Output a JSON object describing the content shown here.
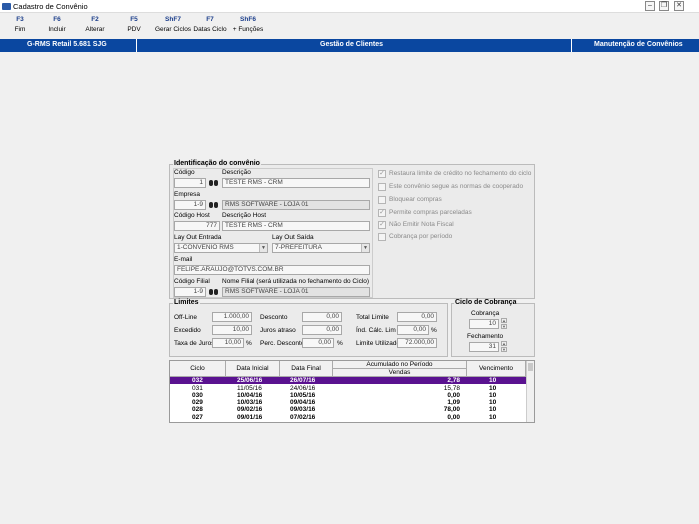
{
  "window": {
    "title": "Cadastro de Convênio"
  },
  "toolbar": [
    {
      "key": "F3",
      "label": "Fim"
    },
    {
      "key": "F6",
      "label": "Incluir"
    },
    {
      "key": "F2",
      "label": "Alterar"
    },
    {
      "key": "F5",
      "label": "PDV"
    },
    {
      "key": "ShF7",
      "label": "Gerar Ciclos"
    },
    {
      "key": "F7",
      "label": "Datas Ciclo"
    },
    {
      "key": "ShF6",
      "label": "+ Funções"
    }
  ],
  "header": {
    "left": "G-RMS Retail 5.681 SJG",
    "center": "Gestão de Clientes",
    "right": "Manutenção de Convênios"
  },
  "identificacao": {
    "group_title": "Identificação do convênio",
    "codigo_label": "Código",
    "codigo": "1",
    "descricao_label": "Descrição",
    "descricao": "TESTE RMS - CRM",
    "empresa_label": "Empresa",
    "empresa_code": "1-9",
    "empresa_name": "RMS SOFTWARE - LOJA 01",
    "codigo_host_label": "Código Host",
    "codigo_host": "777",
    "descricao_host_label": "Descrição Host",
    "descricao_host": "TESTE RMS - CRM",
    "layout_entrada_label": "Lay Out Entrada",
    "layout_entrada": "1-CONVENIO RMS",
    "layout_saida_label": "Lay Out Saída",
    "layout_saida": "7-PREFEITURA",
    "email_label": "E-mail",
    "email": "FELIPE.ARAUJO@TOTVS.COM.BR",
    "codigo_filial_label": "Código Filial",
    "codigo_filial": "1-9",
    "nome_filial_label": "Nome Filial (será utilizada no fechamento do Ciclo)",
    "nome_filial": "RMS SOFTWARE - LOJA 01"
  },
  "options": [
    {
      "label": "Restaura limite de crédito no fechamento do ciclo",
      "checked": true
    },
    {
      "label": "Este convênio segue as normas de cooperado",
      "checked": false
    },
    {
      "label": "Bloquear compras",
      "checked": false
    },
    {
      "label": "Permite compras parceladas",
      "checked": true
    },
    {
      "label": "Não Emitir Nota Fiscal",
      "checked": true
    },
    {
      "label": "Cobrança por período",
      "checked": false
    }
  ],
  "limites": {
    "group_title": "Limites",
    "offline_label": "Off-Line",
    "offline": "1.000,00",
    "excedido_label": "Excedido",
    "excedido": "10,00",
    "taxa_juros_label": "Taxa de Juros",
    "taxa_juros": "10,00",
    "taxa_juros_unit": "%",
    "desconto_label": "Desconto",
    "desconto": "0,00",
    "juros_atraso_label": "Juros atraso",
    "juros_atraso": "0,00",
    "perc_desconto_label": "Perc. Desconto",
    "perc_desconto": "0,00",
    "perc_desconto_unit": "%",
    "total_limite_label": "Total Limite",
    "total_limite": "0,00",
    "ind_calc_lim_label": "Índ. Cálc. Lim",
    "ind_calc_lim": "0,00",
    "ind_calc_lim_unit": "%",
    "limite_utilizado_label": "Limite Utilizado",
    "limite_utilizado": "72.000,00"
  },
  "ciclo_cobranca": {
    "group_title": "Ciclo de Cobrança",
    "cobranca_label": "Cobrança",
    "cobranca": "10",
    "fechamento_label": "Fechamento",
    "fechamento": "31"
  },
  "grid": {
    "headers": {
      "ciclo": "Ciclo",
      "data_inicial": "Data Inicial",
      "data_final": "Data Final",
      "acumulado": "Acumulado no Período",
      "vendas": "Vendas",
      "vencimento": "Vencimento"
    },
    "rows": [
      {
        "ciclo": "032",
        "data_inicial": "25/06/16",
        "data_final": "26/07/16",
        "vendas": "2,78",
        "vencimento": "10"
      },
      {
        "ciclo": "031",
        "data_inicial": "11/05/16",
        "data_final": "24/06/16",
        "vendas": "15,78",
        "vencimento": "10"
      },
      {
        "ciclo": "030",
        "data_inicial": "10/04/16",
        "data_final": "10/05/16",
        "vendas": "0,00",
        "vencimento": "10"
      },
      {
        "ciclo": "029",
        "data_inicial": "10/03/16",
        "data_final": "09/04/16",
        "vendas": "1,09",
        "vencimento": "10"
      },
      {
        "ciclo": "028",
        "data_inicial": "09/02/16",
        "data_final": "09/03/16",
        "vendas": "78,00",
        "vencimento": "10"
      },
      {
        "ciclo": "027",
        "data_inicial": "09/01/16",
        "data_final": "07/02/16",
        "vendas": "0,00",
        "vencimento": "10"
      }
    ]
  }
}
